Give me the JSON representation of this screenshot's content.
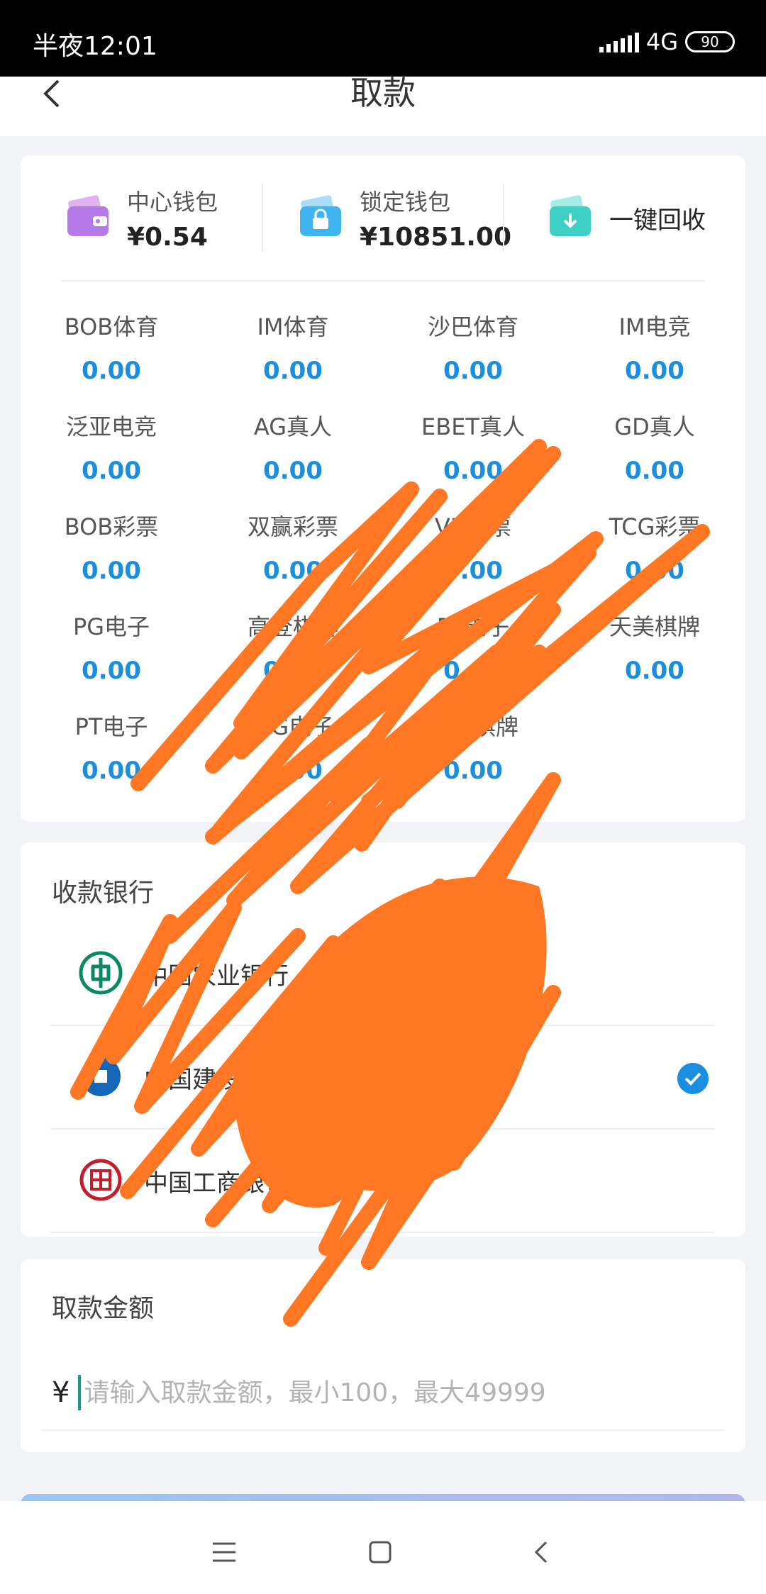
{
  "status_bar": {
    "time": "半夜12:01",
    "network": "4G",
    "battery": "90"
  },
  "header": {
    "title": "取款"
  },
  "wallets": [
    {
      "label": "中心钱包",
      "value": "¥0.54",
      "icon": "wallet-icon"
    },
    {
      "label": "锁定钱包",
      "value": "¥10851.00",
      "icon": "lock-icon"
    },
    {
      "label": "一键回收",
      "icon": "download-icon"
    }
  ],
  "platforms": [
    {
      "name": "BOB体育",
      "value": "0.00"
    },
    {
      "name": "IM体育",
      "value": "0.00"
    },
    {
      "name": "沙巴体育",
      "value": "0.00"
    },
    {
      "name": "IM电竞",
      "value": "0.00"
    },
    {
      "name": "泛亚电竞",
      "value": "0.00"
    },
    {
      "name": "AG真人",
      "value": "0.00"
    },
    {
      "name": "EBET真人",
      "value": "0.00"
    },
    {
      "name": "GD真人",
      "value": "0.00"
    },
    {
      "name": "BOB彩票",
      "value": "0.00"
    },
    {
      "name": "双赢彩票",
      "value": "0.00"
    },
    {
      "name": "VR彩票",
      "value": "0.00"
    },
    {
      "name": "TCG彩票",
      "value": "0.00"
    },
    {
      "name": "PG电子",
      "value": "0.00"
    },
    {
      "name": "高登棋牌",
      "value": "0.00"
    },
    {
      "name": "PP电子",
      "value": "0.00"
    },
    {
      "name": "天美棋牌",
      "value": "0.00"
    },
    {
      "name": "PT电子",
      "value": "0.00"
    },
    {
      "name": "MG电子",
      "value": "0.00"
    },
    {
      "name": "开元棋牌",
      "value": "0.00"
    }
  ],
  "bank_section": {
    "title": "收款银行",
    "banks": [
      {
        "name": "中国农业银行",
        "icon": "abc-bank-icon",
        "selected": false
      },
      {
        "name": "中国建设银行",
        "icon": "ccb-bank-icon",
        "selected": true
      },
      {
        "name": "中国工商银行( )",
        "icon": "icbc-bank-icon",
        "selected": false
      }
    ]
  },
  "amount_section": {
    "title": "取款金额",
    "currency": "¥",
    "placeholder": "请输入取款金额，最小100，最大49999"
  },
  "colors": {
    "accent": "#1a8fe0",
    "scribble": "#ff7722"
  }
}
